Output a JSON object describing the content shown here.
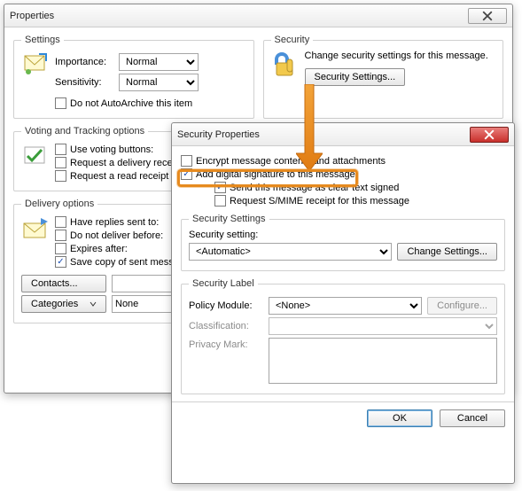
{
  "properties": {
    "title": "Properties",
    "settings_legend": "Settings",
    "importance_label": "Importance:",
    "importance_value": "Normal",
    "sensitivity_label": "Sensitivity:",
    "sensitivity_value": "Normal",
    "autoarchive_label": "Do not AutoArchive this item",
    "security_legend": "Security",
    "security_desc": "Change security settings for this message.",
    "security_settings_btn": "Security Settings...",
    "voting_legend": "Voting and Tracking options",
    "use_voting_label": "Use voting buttons:",
    "delivery_receipt_label": "Request a delivery receipt",
    "read_receipt_label": "Request a read receipt",
    "delivery_legend": "Delivery options",
    "have_replies_label": "Have replies sent to:",
    "deliver_before_label": "Do not deliver before:",
    "expires_after_label": "Expires after:",
    "save_copy_label": "Save copy of sent message",
    "contacts_btn": "Contacts...",
    "categories_btn": "Categories",
    "categories_value": "None"
  },
  "secprops": {
    "title": "Security Properties",
    "encrypt_label": "Encrypt message contents and attachments",
    "sign_label": "Add digital signature to this message",
    "cleartext_label": "Send this message as clear text signed",
    "smime_label": "Request S/MIME receipt for this message",
    "sec_settings_legend": "Security Settings",
    "sec_setting_label": "Security setting:",
    "sec_setting_value": "<Automatic>",
    "change_settings_btn": "Change Settings...",
    "sec_label_legend": "Security Label",
    "policy_label": "Policy Module:",
    "policy_value": "<None>",
    "configure_btn": "Configure...",
    "classification_label": "Classification:",
    "privacy_label": "Privacy Mark:",
    "ok_btn": "OK",
    "cancel_btn": "Cancel"
  }
}
